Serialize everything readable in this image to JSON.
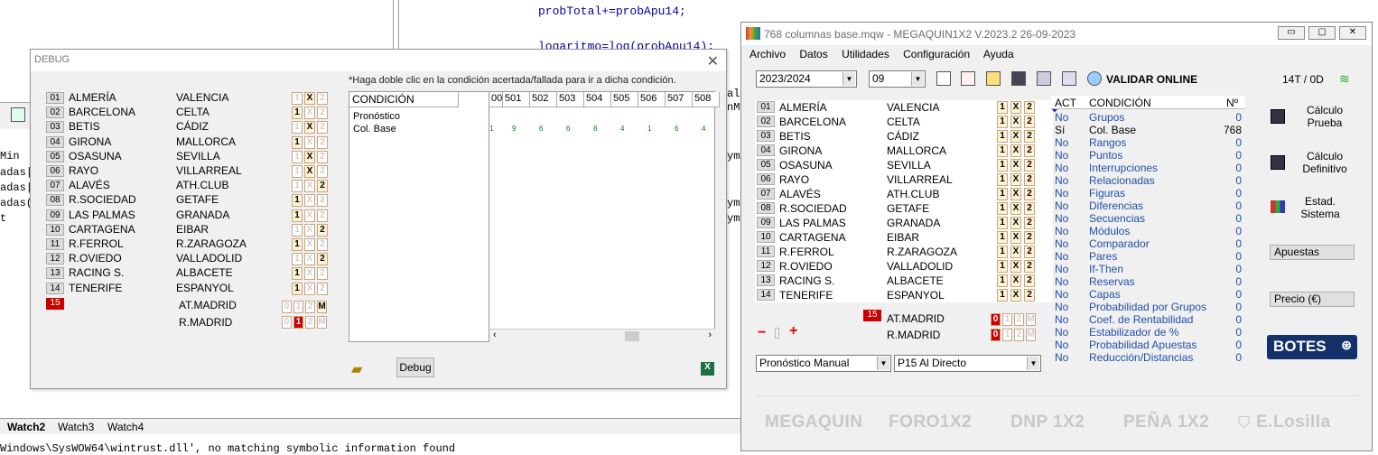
{
  "ide": {
    "code_lines": [
      "probTotal+=probApu14;",
      "logaritmo=log(probApu14);"
    ],
    "side_fragments": [
      "Min",
      "adas|",
      "adas|",
      "adas(",
      "t"
    ],
    "right_fragments": [
      "al",
      "nM",
      "ym",
      "ym",
      "ym"
    ],
    "tabs": [
      "Watch2",
      "Watch3",
      "Watch4"
    ],
    "output_line": "Windows\\SysWOW64\\wintrust.dll', no matching symbolic information found"
  },
  "debug": {
    "title": "DEBUG",
    "hint": "*Haga doble clic en la condición acertada/fallada para ir a dicha condición.",
    "matches": [
      {
        "n": "01",
        "home": "ALMERÍA",
        "away": "VALENCIA",
        "marks": "x"
      },
      {
        "n": "02",
        "home": "BARCELONA",
        "away": "CELTA",
        "marks": "1"
      },
      {
        "n": "03",
        "home": "BETIS",
        "away": "CÁDIZ",
        "marks": "x"
      },
      {
        "n": "04",
        "home": "GIRONA",
        "away": "MALLORCA",
        "marks": "1"
      },
      {
        "n": "05",
        "home": "OSASUNA",
        "away": "SEVILLA",
        "marks": "x"
      },
      {
        "n": "06",
        "home": "RAYO",
        "away": "VILLARREAL",
        "marks": "x"
      },
      {
        "n": "07",
        "home": "ALAVÉS",
        "away": "ATH.CLUB",
        "marks": "2"
      },
      {
        "n": "08",
        "home": "R.SOCIEDAD",
        "away": "GETAFE",
        "marks": "1"
      },
      {
        "n": "09",
        "home": "LAS PALMAS",
        "away": "GRANADA",
        "marks": "1"
      },
      {
        "n": "10",
        "home": "CARTAGENA",
        "away": "EIBAR",
        "marks": "2"
      },
      {
        "n": "11",
        "home": "R.FERROL",
        "away": "R.ZARAGOZA",
        "marks": "1"
      },
      {
        "n": "12",
        "home": "R.OVIEDO",
        "away": "VALLADOLID",
        "marks": "2"
      },
      {
        "n": "13",
        "home": "RACING S.",
        "away": "ALBACETE",
        "marks": "1"
      },
      {
        "n": "14",
        "home": "TENERIFE",
        "away": "ESPANYOL",
        "marks": "1"
      }
    ],
    "p15": {
      "n": "15",
      "home": "AT.MADRID",
      "away": "R.MADRID",
      "home_marks": [
        "0",
        "1",
        "2",
        "M"
      ],
      "away_marks": [
        "0",
        "1",
        "2",
        "M"
      ]
    },
    "table": {
      "col_condicion": "CONDICIÓN",
      "rows": [
        "Pronóstico",
        "Col. Base"
      ],
      "columns": [
        "00",
        "501",
        "502",
        "503",
        "504",
        "505",
        "506",
        "507",
        "508"
      ],
      "colbase_values": [
        "1",
        "9",
        "6",
        "6",
        "8",
        "4",
        "1",
        "6",
        "4"
      ]
    },
    "debug_button": "Debug"
  },
  "mq": {
    "title": "768 columnas base.mqw - MEGAQUIN1X2  V.2023.2 26-09-2023",
    "menu": [
      "Archivo",
      "Datos",
      "Utilidades",
      "Configuración",
      "Ayuda"
    ],
    "season": "2023/2024",
    "jornada": "09",
    "validar": "VALIDAR ONLINE",
    "counter": "14T / 0D",
    "matches": [
      {
        "n": "01",
        "home": "ALMERÍA",
        "away": "VALENCIA"
      },
      {
        "n": "02",
        "home": "BARCELONA",
        "away": "CELTA"
      },
      {
        "n": "03",
        "home": "BETIS",
        "away": "CÁDIZ"
      },
      {
        "n": "04",
        "home": "GIRONA",
        "away": "MALLORCA"
      },
      {
        "n": "05",
        "home": "OSASUNA",
        "away": "SEVILLA"
      },
      {
        "n": "06",
        "home": "RAYO",
        "away": "VILLARREAL"
      },
      {
        "n": "07",
        "home": "ALAVÉS",
        "away": "ATH.CLUB"
      },
      {
        "n": "08",
        "home": "R.SOCIEDAD",
        "away": "GETAFE"
      },
      {
        "n": "09",
        "home": "LAS PALMAS",
        "away": "GRANADA"
      },
      {
        "n": "10",
        "home": "CARTAGENA",
        "away": "EIBAR"
      },
      {
        "n": "11",
        "home": "R.FERROL",
        "away": "R.ZARAGOZA"
      },
      {
        "n": "12",
        "home": "R.OVIEDO",
        "away": "VALLADOLID"
      },
      {
        "n": "13",
        "home": "RACING S.",
        "away": "ALBACETE"
      },
      {
        "n": "14",
        "home": "TENERIFE",
        "away": "ESPANYOL"
      }
    ],
    "p15": {
      "n": "15",
      "home": "AT.MADRID",
      "away": "R.MADRID"
    },
    "cond_headers": {
      "act": "ACT",
      "cond": "CONDICIÓN",
      "num": "Nº"
    },
    "conditions": [
      {
        "act": "No",
        "name": "Grupos",
        "n": "0"
      },
      {
        "act": "Sí",
        "name": "Col. Base",
        "n": "768"
      },
      {
        "act": "No",
        "name": "Rangos",
        "n": "0"
      },
      {
        "act": "No",
        "name": "Puntos",
        "n": "0"
      },
      {
        "act": "No",
        "name": "Interrupciones",
        "n": "0"
      },
      {
        "act": "No",
        "name": "Relacionadas",
        "n": "0"
      },
      {
        "act": "No",
        "name": "Figuras",
        "n": "0"
      },
      {
        "act": "No",
        "name": "Diferencias",
        "n": "0"
      },
      {
        "act": "No",
        "name": "Secuencias",
        "n": "0"
      },
      {
        "act": "No",
        "name": "Módulos",
        "n": "0"
      },
      {
        "act": "No",
        "name": "Comparador",
        "n": "0"
      },
      {
        "act": "No",
        "name": "Pares",
        "n": "0"
      },
      {
        "act": "No",
        "name": "If-Then",
        "n": "0"
      },
      {
        "act": "No",
        "name": "Reservas",
        "n": "0"
      },
      {
        "act": "No",
        "name": "Capas",
        "n": "0"
      },
      {
        "act": "No",
        "name": "Probabilidad por Grupos",
        "n": "0"
      },
      {
        "act": "No",
        "name": "Coef. de Rentabilidad",
        "n": "0"
      },
      {
        "act": "No",
        "name": "Estabilizador de %",
        "n": "0"
      },
      {
        "act": "No",
        "name": "Probabilidad Apuestas",
        "n": "0"
      },
      {
        "act": "No",
        "name": "Reducción/Distancias",
        "n": "0"
      }
    ],
    "side": {
      "calc_prueba": "Cálculo Prueba",
      "calc_def": "Cálculo Definitivo",
      "estad": "Estad. Sistema",
      "apuestas": "Apuestas",
      "precio": "Precio (€)",
      "botes": "BOTES"
    },
    "pron_select": "Pronóstico Manual",
    "p15_select": "P15 Al Directo",
    "footer": [
      "MEGAQUIN",
      "FORO1X2",
      "DNP 1X2",
      "PEÑA 1X2",
      "E.Losilla"
    ],
    "minus": "−",
    "plus": "+"
  }
}
